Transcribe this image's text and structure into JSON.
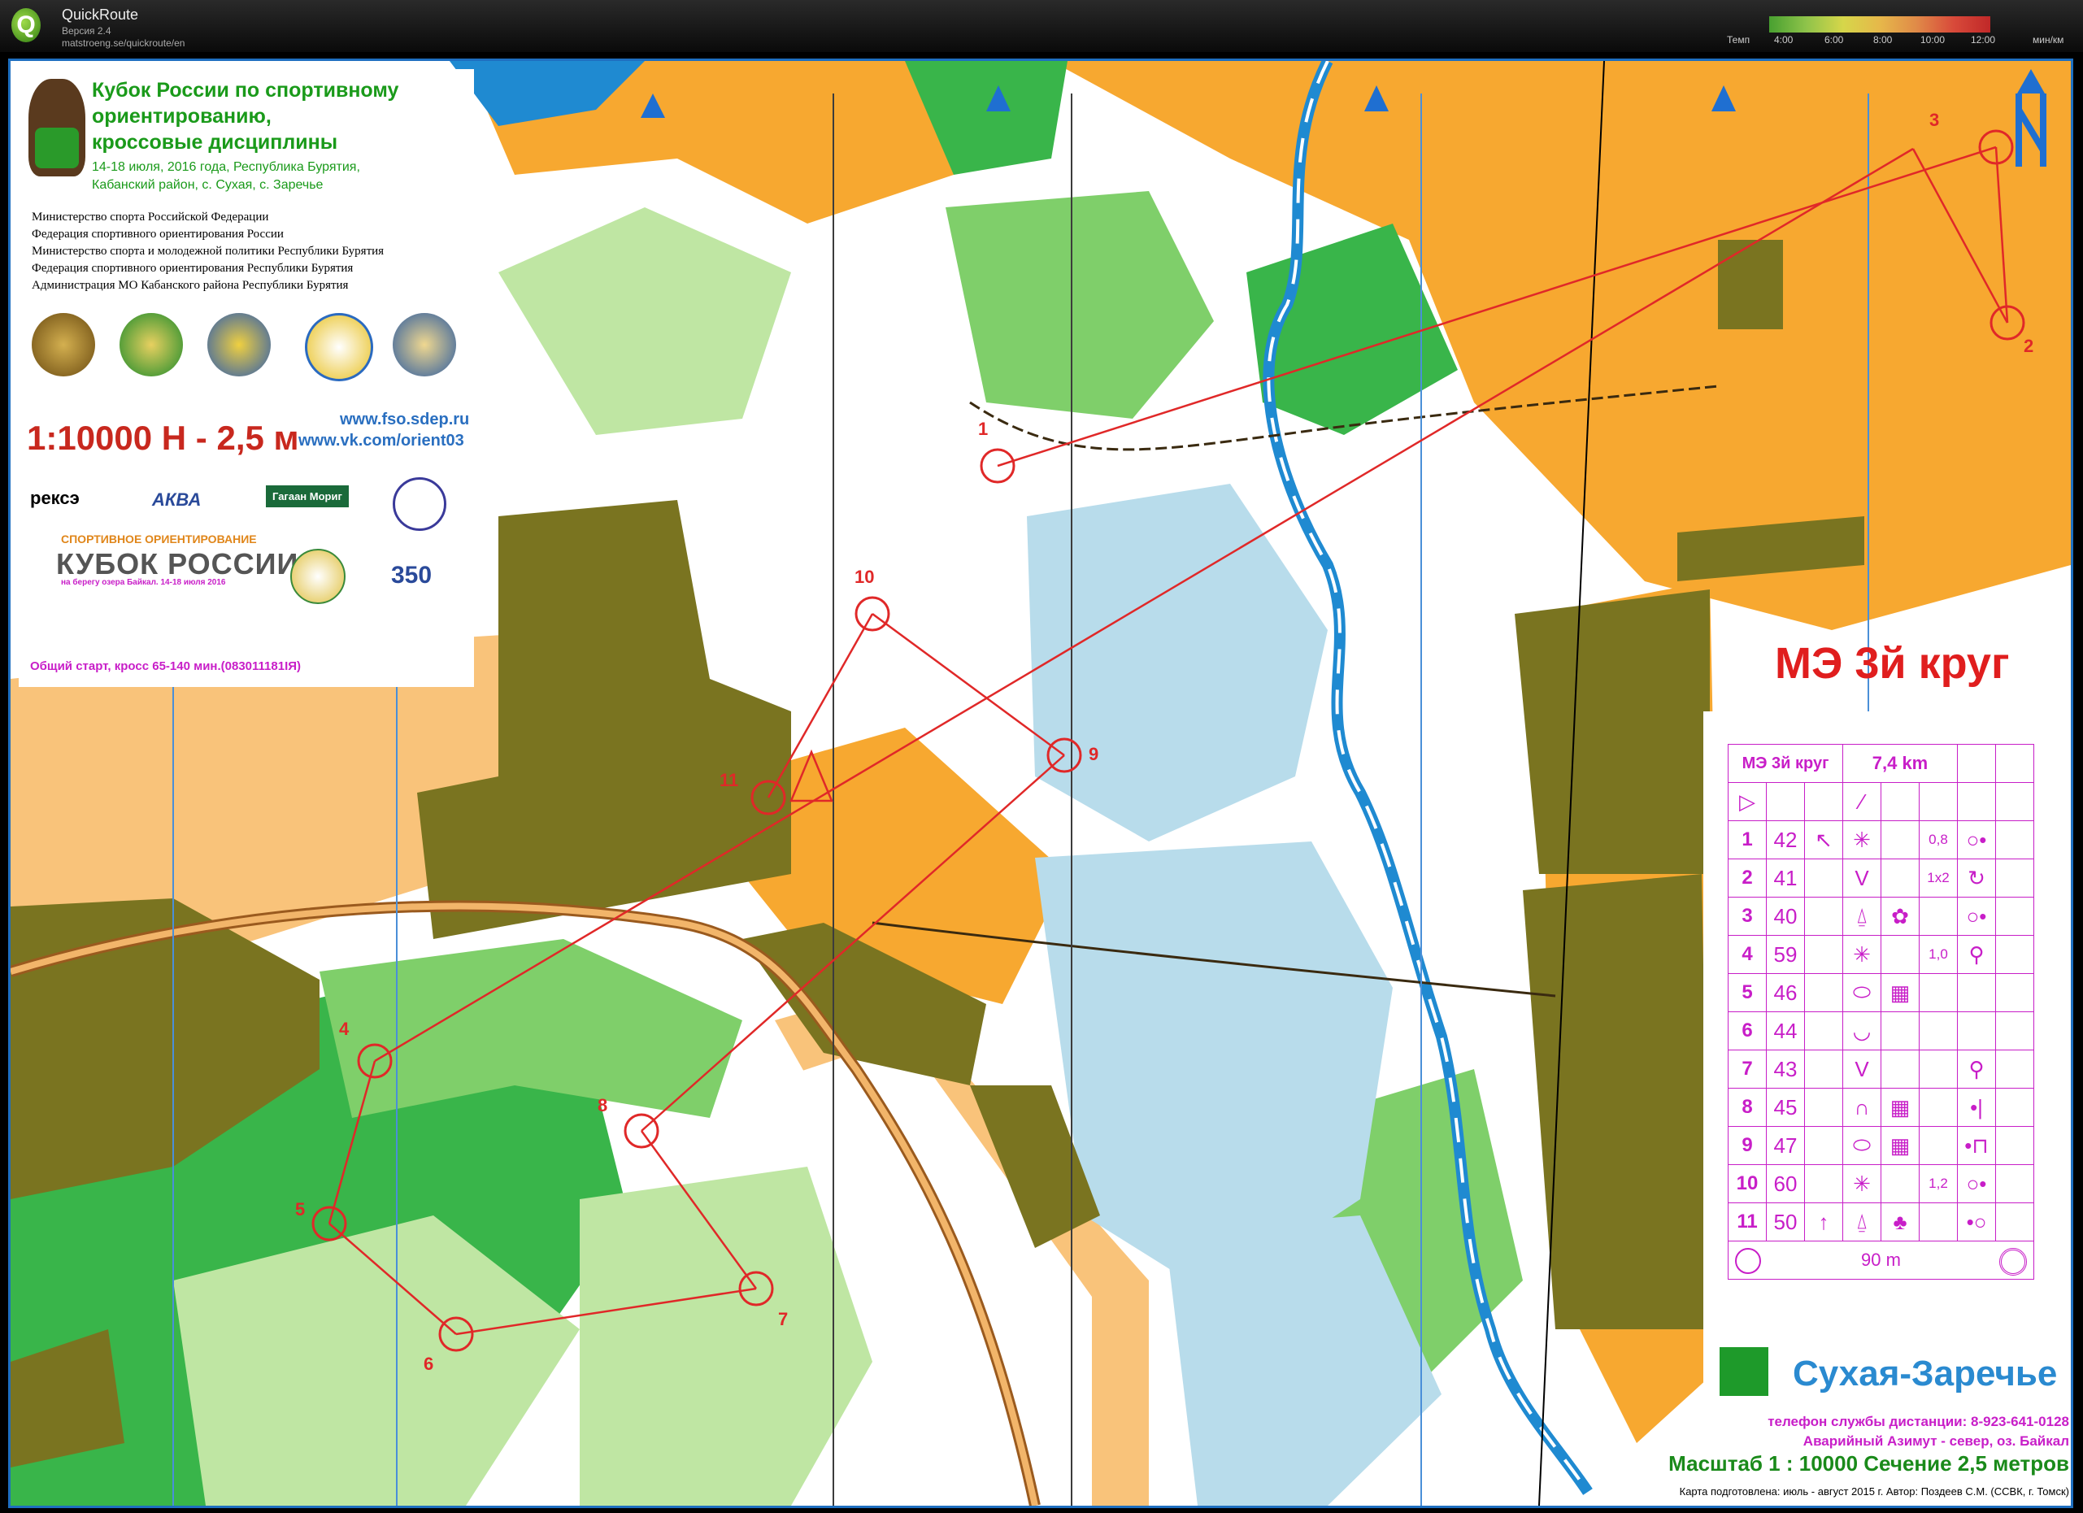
{
  "app": {
    "title": "QuickRoute",
    "version": "Версия 2.4",
    "url": "matstroeng.se/quickroute/en",
    "pace_label": "Темп",
    "pace_ticks": [
      "4:00",
      "6:00",
      "8:00",
      "10:00",
      "12:00"
    ],
    "pace_unit": "мин/км"
  },
  "header": {
    "event_title_1": "Кубок России по спортивному",
    "event_title_2": "ориентированию,",
    "event_title_3": "кроссовые дисциплины",
    "event_dates": "14-18 июля, 2016 года, Республика Бурятия,",
    "event_place": "Кабанский район, с. Сухая, с. Заречье",
    "organizers": [
      "Министерство спорта Российской Федерации",
      "Федерация спортивного ориентирования России",
      "Министерство спорта и молодежной политики Республики Бурятия",
      "Федерация спортивного ориентирования Республики Бурятия",
      "Администрация МО Кабанского района Республики Бурятия"
    ],
    "scale_line": "1:10000  Н - 2,5 м",
    "web_1": "www.fso.sdep.ru",
    "web_2": "www.vk.com/orient03",
    "sponsor_1": "рексэ",
    "sponsor_2": "АКВА",
    "sponsor_3": "Гагаан Мориг",
    "cup_sub1": "СПОРТИВНОЕ ОРИЕНТИРОВАНИЕ",
    "cup_title": "КУБОК РОССИИ",
    "cup_sub2": "на берегу озера Байкал. 14-18 июля 2016",
    "badge_350": "350",
    "mass_start": "Общий старт, кросс 65-140 мин.(083011181ІЯ)"
  },
  "course": {
    "title": "МЭ 3й круг",
    "table_header_name": "МЭ 3й круг",
    "table_header_length": "7,4 km",
    "finish_distance": "90 m",
    "controls": [
      {
        "num": "1",
        "code": "42",
        "c": "↖",
        "d": "✳",
        "e": "",
        "f": "0,8",
        "g": "○•"
      },
      {
        "num": "2",
        "code": "41",
        "c": "",
        "d": "V",
        "e": "",
        "f": "1x2",
        "g": "↻"
      },
      {
        "num": "3",
        "code": "40",
        "c": "",
        "d": "⍙",
        "e": "✿",
        "f": "",
        "g": "○•"
      },
      {
        "num": "4",
        "code": "59",
        "c": "",
        "d": "✳",
        "e": "",
        "f": "1,0",
        "g": "⚲"
      },
      {
        "num": "5",
        "code": "46",
        "c": "",
        "d": "⬭",
        "e": "▦",
        "f": "",
        "g": ""
      },
      {
        "num": "6",
        "code": "44",
        "c": "",
        "d": "◡",
        "e": "",
        "f": "",
        "g": ""
      },
      {
        "num": "7",
        "code": "43",
        "c": "",
        "d": "V",
        "e": "",
        "f": "",
        "g": "⚲"
      },
      {
        "num": "8",
        "code": "45",
        "c": "",
        "d": "∩",
        "e": "▦",
        "f": "",
        "g": "•|"
      },
      {
        "num": "9",
        "code": "47",
        "c": "",
        "d": "⬭",
        "e": "▦",
        "f": "",
        "g": "•⊓"
      },
      {
        "num": "10",
        "code": "60",
        "c": "",
        "d": "✳",
        "e": "",
        "f": "1,2",
        "g": "○•"
      },
      {
        "num": "11",
        "code": "50",
        "c": "↑",
        "d": "⍙",
        "e": "♣",
        "f": "",
        "g": "•○"
      }
    ],
    "map_labels": [
      "1",
      "2",
      "3",
      "4",
      "5",
      "6",
      "7",
      "8",
      "9",
      "10",
      "11"
    ]
  },
  "footer": {
    "area_name": "Сухая-Заречье",
    "phone": "телефон службы дистанции: 8-923-641-0128",
    "emergency": "Аварийный Азимут  - север, оз. Байкал",
    "map_scale": "Масштаб 1 : 10000  Сечение 2,5 метров",
    "credits": "Карта подготовлена:  июль - август 2015 г. Автор: Поздеев С.М. (ССВК, г. Томск)"
  },
  "colors": {
    "open": "#f7a830",
    "forest": "#ffffff",
    "green": "#39b54a",
    "light_green": "#bfe6a3",
    "marsh_blue": "#b8dceb",
    "water": "#1f8ad1",
    "building": "#7a7420",
    "course": "#e02828",
    "description": "#c81ec8"
  }
}
